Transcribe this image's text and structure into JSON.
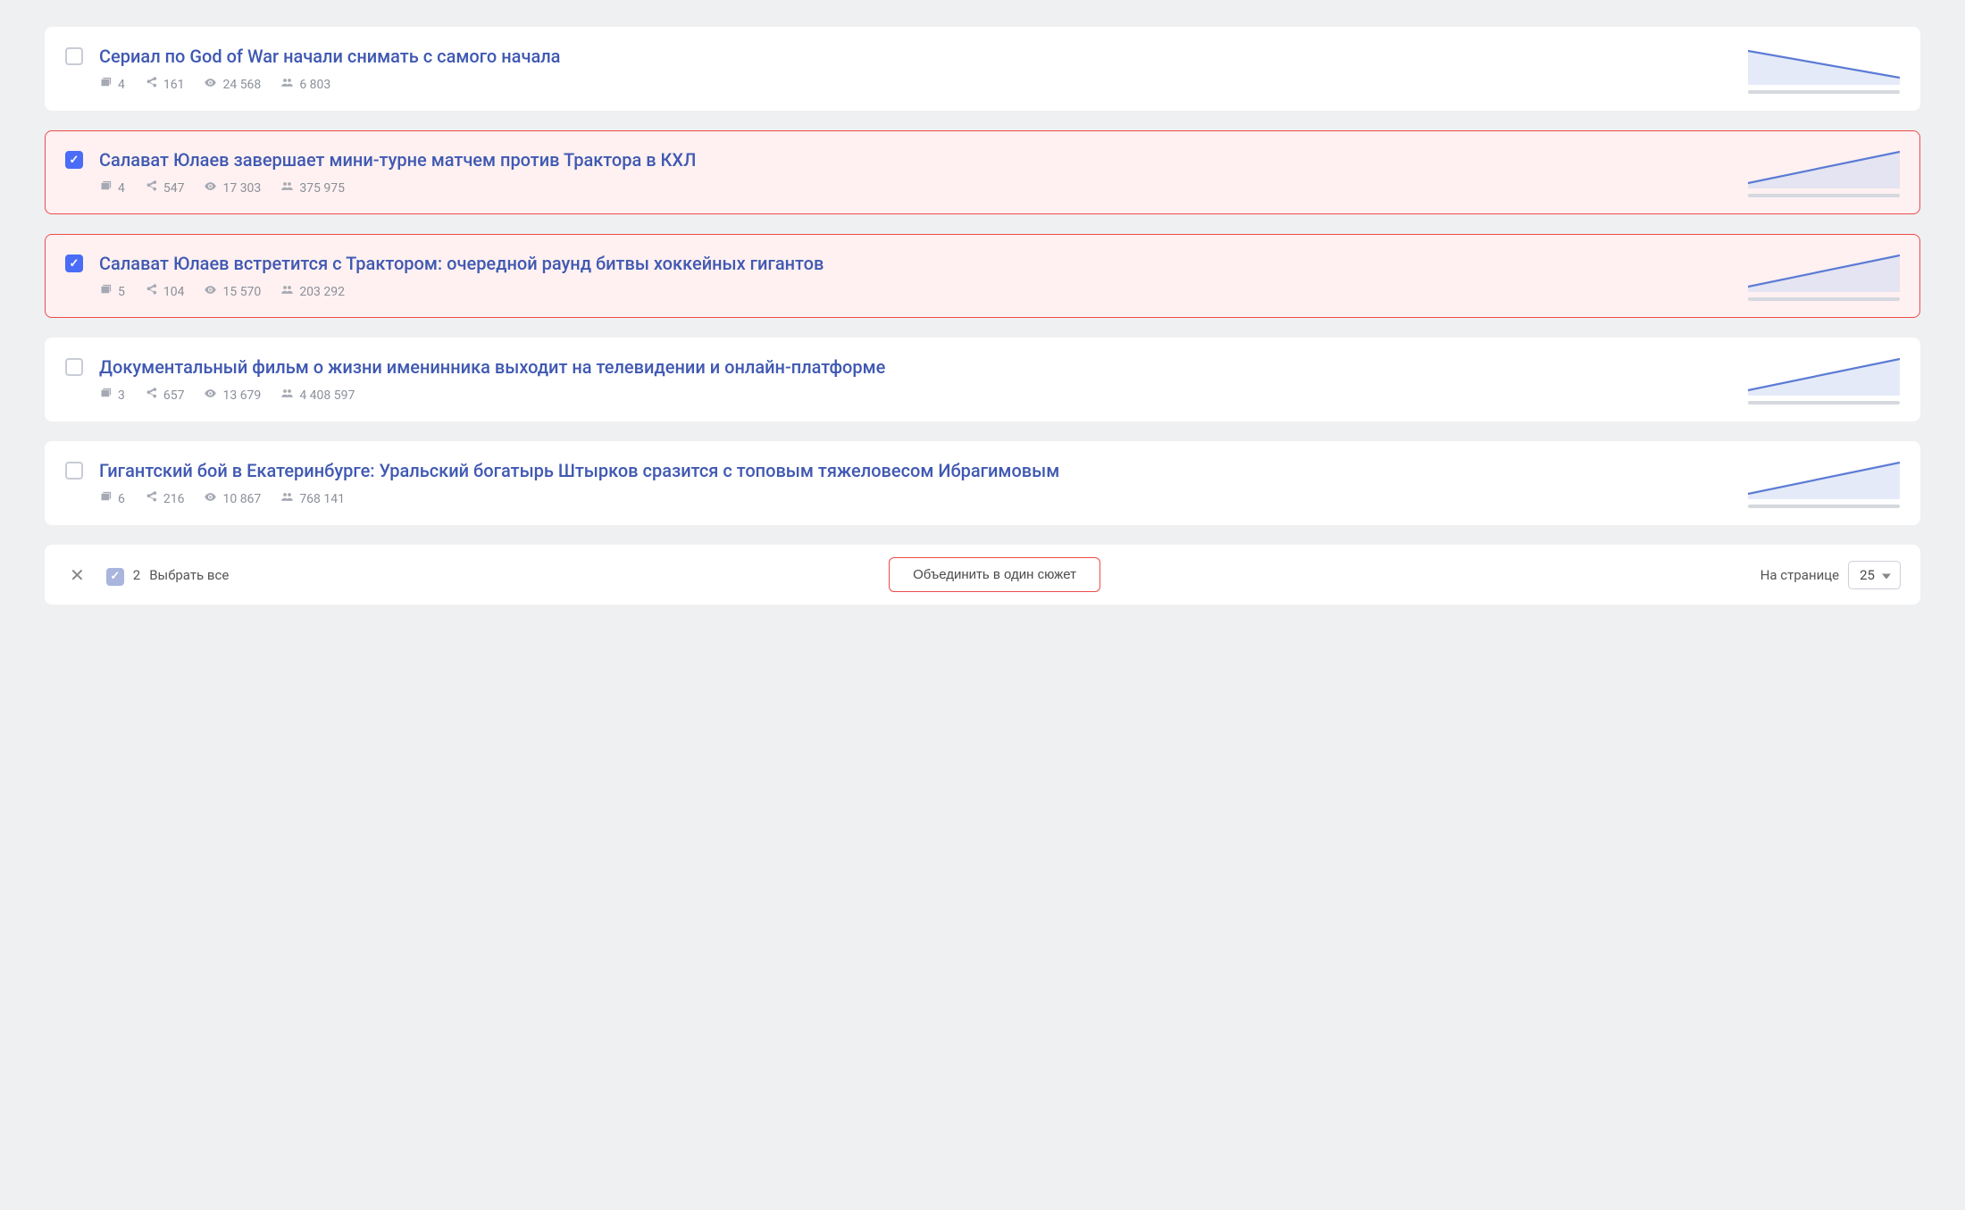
{
  "items": [
    {
      "selected": false,
      "title": "Сериал по God of War начали снимать с самого начала",
      "boxes": "4",
      "shares": "161",
      "views": "24 568",
      "audience": "6 803",
      "trend": "down"
    },
    {
      "selected": true,
      "title": "Салават Юлаев завершает мини-турне матчем против Трактора в КХЛ",
      "boxes": "4",
      "shares": "547",
      "views": "17 303",
      "audience": "375 975",
      "trend": "up"
    },
    {
      "selected": true,
      "title": "Салават Юлаев встретится с Трактором: очередной раунд битвы хоккейных гигантов",
      "boxes": "5",
      "shares": "104",
      "views": "15 570",
      "audience": "203 292",
      "trend": "up"
    },
    {
      "selected": false,
      "title": "Документальный фильм о жизни именинника выходит на телевидении и онлайн-платформе",
      "boxes": "3",
      "shares": "657",
      "views": "13 679",
      "audience": "4 408 597",
      "trend": "up"
    },
    {
      "selected": false,
      "title": "Гигантский бой в Екатеринбурге: Уральский богатырь Штырков сразится с топовым тяжеловесом Ибрагимовым",
      "boxes": "6",
      "shares": "216",
      "views": "10 867",
      "audience": "768 141",
      "trend": "up"
    }
  ],
  "footer": {
    "selected_count": "2",
    "select_all_label": "Выбрать все",
    "merge_label": "Объединить в один сюжет",
    "per_page_label": "На странице",
    "per_page_value": "25"
  }
}
